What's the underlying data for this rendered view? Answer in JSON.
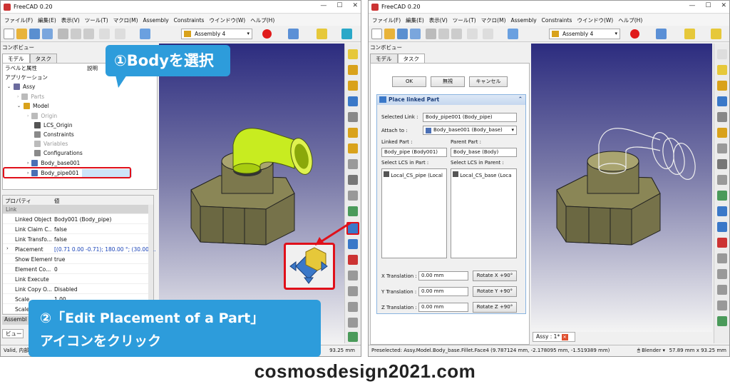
{
  "left_window": {
    "title": "FreeCAD 0.20",
    "menu": [
      "ファイル(F)",
      "編集(E)",
      "表示(V)",
      "ツール(T)",
      "マクロ(M)",
      "Assembly",
      "Constraints",
      "ウインドウ(W)",
      "ヘルプ(H)"
    ],
    "assembly_combo": "Assembly 4",
    "combo_view_title": "コンボビュー",
    "tabs": [
      "モデル",
      "タスク"
    ],
    "tree_header": {
      "label": "ラベルと属性",
      "desc": "説明"
    },
    "tree": {
      "application": "アプリケーション",
      "assy": "Assy",
      "parts": "Parts",
      "model": "Model",
      "origin": "Origin",
      "lcs_origin": "LCS_Origin",
      "constraints": "Constraints",
      "variables": "Variables",
      "configurations": "Configurations",
      "body_base": "Body_base001",
      "body_pipe": "Body_pipe001"
    },
    "props_header": {
      "prop": "プロパティ",
      "value": "値"
    },
    "props_group": "Link",
    "props": [
      {
        "name": "Linked Object",
        "value": "Body001 (Body_pipe)"
      },
      {
        "name": "Link Claim C...",
        "value": "false"
      },
      {
        "name": "Link Transfo...",
        "value": "false"
      },
      {
        "name": "Placement",
        "value": "[(0.71 0.00 -0.71); 180.00 °; (30.00 ..."
      },
      {
        "name": "Show Element",
        "value": "true"
      },
      {
        "name": "Element Co...",
        "value": "0"
      },
      {
        "name": "Link Execute",
        "value": ""
      },
      {
        "name": "Link Copy O...",
        "value": "Disabled"
      },
      {
        "name": "Scale",
        "value": "1.00"
      },
      {
        "name": "Scale",
        "value": ""
      }
    ],
    "props_group2": "Assembl",
    "view_tab": "ビュー",
    "status_left": "Valid, 内部",
    "status_right": "93.25 mm"
  },
  "callouts": {
    "step1": "①Bodyを選択",
    "step2_line1": "②「Edit Placement of a Part」",
    "step2_line2": "アイコンをクリック"
  },
  "right_window": {
    "title": "FreeCAD 0.20",
    "menu": [
      "ファイル(F)",
      "編集(E)",
      "表示(V)",
      "ツール(T)",
      "マクロ(M)",
      "Assembly",
      "Constraints",
      "ウインドウ(W)",
      "ヘルプ(H)"
    ],
    "assembly_combo": "Assembly 4",
    "combo_view_title": "コンボビュー",
    "tabs": [
      "モデル",
      "タスク"
    ],
    "buttons": {
      "ok": "OK",
      "ignore": "無視",
      "cancel": "キャンセル"
    },
    "panel_title": "Place linked Part",
    "selected_link_label": "Selected Link :",
    "selected_link_value": "Body_pipe001 (Body_pipe)",
    "attach_to_label": "Attach to :",
    "attach_to_value": "Body_base001 (Body_base)",
    "linked_part_label": "Linked Part :",
    "linked_part_value": "Body_pipe (Body001)",
    "parent_part_label": "Parent Part :",
    "parent_part_value": "Body_base (Body)",
    "lcs_part_label": "Select LCS in Part :",
    "lcs_parent_label": "Select LCS in Parent :",
    "lcs_part_item": "Local_CS_pipe (Local",
    "lcs_parent_item": "Local_CS_base (Loca",
    "x_label": "X Translation :",
    "y_label": "Y Translation :",
    "z_label": "Z Translation :",
    "x_value": "0.00 mm",
    "y_value": "0.00 mm",
    "z_value": "0.00 mm",
    "rot_x": "Rotate X +90°",
    "rot_y": "Rotate Y +90°",
    "rot_z": "Rotate Z +90°",
    "doc_tab": "Assy : 1*",
    "status_left": "Preselected: Assy.Model.Body_base.Fillet.Face4 (9.787124 mm, -2.178095 mm, -1.519389 mm)",
    "status_nav": "Blender",
    "status_right": "57.89 mm x 93.25 mm"
  },
  "footer": "cosmosdesign2021.com",
  "colors": {
    "callout": "#2d9cdb",
    "highlight": "#e0101a",
    "pipe_selected": "#c8ec20",
    "base": "#76724a"
  }
}
